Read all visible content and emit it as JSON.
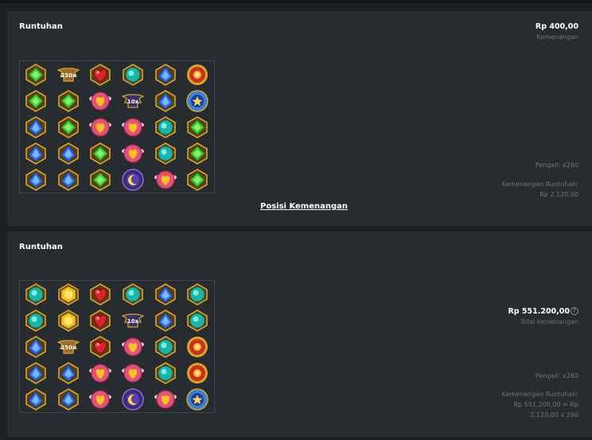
{
  "cascades": [
    {
      "title": "Runtuhan",
      "amount": "Rp 400,00",
      "amount_label": "Kemenangan",
      "multiplier_text": "Pengali: x260",
      "cascade_win_label": "Kemenangan Runtuhan:",
      "cascade_win_value": "Rp 2.120,00",
      "link_label": "Posisi Kemenangan",
      "grid": [
        [
          "green-gem",
          "multiplier-250x",
          "red-heart-gem",
          "teal-gem",
          "blue-gem",
          "sun-scatter"
        ],
        [
          "green-gem",
          "green-gem",
          "pink-heart",
          "multiplier-10x",
          "blue-gem",
          "star-scatter"
        ],
        [
          "blue-gem",
          "green-gem",
          "pink-heart",
          "pink-heart",
          "teal-gem",
          "green-gem"
        ],
        [
          "blue-gem",
          "blue-gem",
          "green-gem",
          "pink-heart",
          "teal-gem",
          "green-gem"
        ],
        [
          "blue-gem",
          "blue-gem",
          "green-gem",
          "moon-scatter",
          "pink-heart",
          "green-gem"
        ]
      ]
    },
    {
      "title": "Runtuhan",
      "total_amount": "Rp 551.200,00",
      "total_label": "Total kemenangan",
      "help_glyph": "?",
      "multiplier_text": "Pengali: x260",
      "cascade_win_label": "Kemenangan Runtuhan:",
      "cascade_win_line1": "Rp 551.200,00 = Rp",
      "cascade_win_line2": "2.120,00 x 260",
      "grid": [
        [
          "teal-gem",
          "yellow-gem",
          "red-heart-gem",
          "teal-gem",
          "blue-gem",
          "teal-gem"
        ],
        [
          "teal-gem",
          "yellow-gem",
          "red-heart-gem",
          "multiplier-10x",
          "blue-gem",
          "teal-gem"
        ],
        [
          "blue-gem",
          "multiplier-250x",
          "red-heart-gem",
          "pink-heart",
          "teal-gem",
          "sun-scatter"
        ],
        [
          "blue-gem",
          "blue-gem",
          "pink-heart",
          "pink-heart",
          "teal-gem",
          "sun-scatter"
        ],
        [
          "blue-gem",
          "blue-gem",
          "pink-heart",
          "moon-scatter",
          "pink-heart",
          "star-scatter"
        ]
      ]
    }
  ],
  "multiplier_labels": {
    "multiplier-250x": "250x",
    "multiplier-10x": "10x"
  },
  "colors": {
    "page_bg": "#1b1f22",
    "card_bg": "#272c30",
    "muted_text": "#6d757b",
    "gold": "#d9a52a"
  }
}
